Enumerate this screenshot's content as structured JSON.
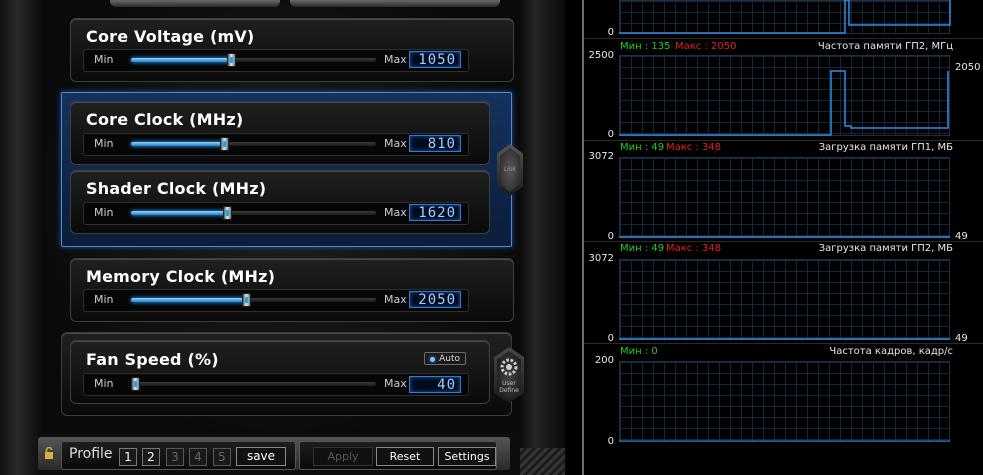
{
  "controls": {
    "min_label": "Min",
    "max_label": "Max",
    "core_voltage": {
      "title": "Core Voltage (mV)",
      "value": "1050",
      "level": 0.41
    },
    "core_clock": {
      "title": "Core Clock (MHz)",
      "value": "810",
      "level": 0.38
    },
    "shader_clock": {
      "title": "Shader Clock (MHz)",
      "value": "1620",
      "level": 0.39
    },
    "memory_clock": {
      "title": "Memory Clock (MHz)",
      "value": "2050",
      "level": 0.47
    },
    "fan_speed": {
      "title": "Fan Speed (%)",
      "value": "40",
      "level": 0.0,
      "auto_label": "Auto"
    },
    "link_label": "Link",
    "user_define_label": "User Define"
  },
  "bottom_bar": {
    "profile_label": "Profile",
    "profiles": [
      "1",
      "2",
      "3",
      "4",
      "5"
    ],
    "save_label": "save",
    "apply_label": "Apply",
    "reset_label": "Reset",
    "settings_label": "Settings"
  },
  "monitor": {
    "graphs": [
      {
        "min_label": "Мин : 135",
        "max_label": "Макс : 2050",
        "title": "Частота памяти ГП2, МГц",
        "y_top": "2500",
        "y_bottom": "0",
        "current": "2050",
        "line_color": "#2f8ee8"
      },
      {
        "min_label": "Мин : 49",
        "max_label": "Макс : 348",
        "title": "Загрузка памяти ГП1, МБ",
        "y_top": "3072",
        "y_bottom": "0",
        "current": "49",
        "line_color": "#2f8ee8"
      },
      {
        "min_label": "Мин : 49",
        "max_label": "Макс : 348",
        "title": "Загрузка памяти ГП2, МБ",
        "y_top": "3072",
        "y_bottom": "0",
        "current": "49",
        "line_color": "#2f8ee8"
      },
      {
        "min_label": "Мин : 0",
        "max_label": "",
        "title": "Частота кадров, кадр/с",
        "y_top": "200",
        "y_bottom": "0",
        "current": "",
        "line_color": "#2f8ee8"
      }
    ],
    "top_graph_y_bottom": "0"
  }
}
